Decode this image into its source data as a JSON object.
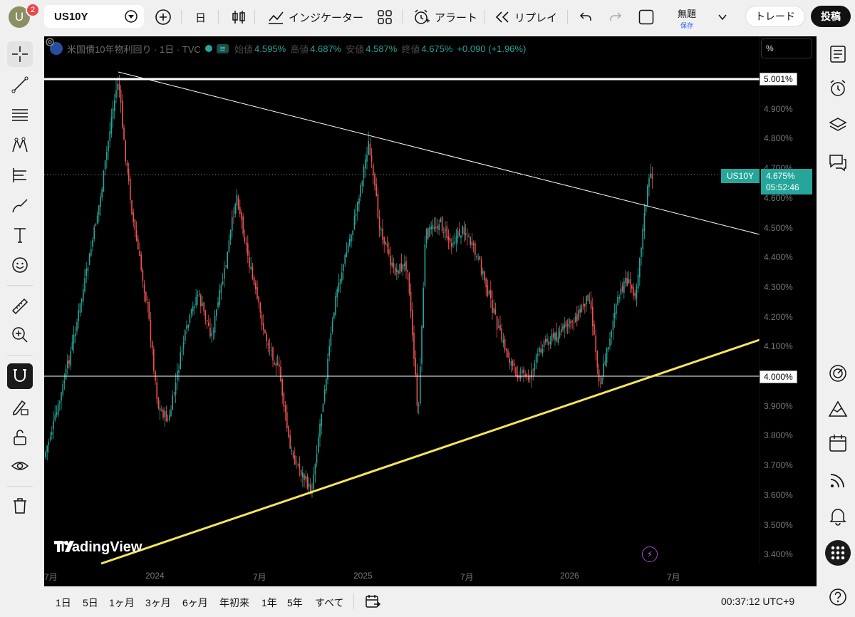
{
  "top": {
    "avatar_letter": "U",
    "notif_count": "2",
    "symbol": "US10Y",
    "timeframe": "日",
    "indicators": "インジケーター",
    "alert": "アラート",
    "replay": "リプレイ",
    "layout_title": "無題",
    "layout_saved": "保存",
    "trade": "トレード",
    "post": "投稿"
  },
  "legend": {
    "title": "米国債10年物利回り · 1日 · TVC",
    "wave": "≋",
    "open_label": "始値",
    "open": "4.595%",
    "high_label": "高値",
    "high": "4.687%",
    "low_label": "安値",
    "low": "4.587%",
    "close_label": "終値",
    "close": "4.675%",
    "change": "+0.090 (+1.96%)"
  },
  "scale_mode": "%",
  "price_axis": {
    "ticks": [
      "4.900%",
      "4.800%",
      "4.700%",
      "4.600%",
      "4.500%",
      "4.400%",
      "4.300%",
      "4.200%",
      "4.100%",
      "3.900%",
      "3.800%",
      "3.700%",
      "3.600%",
      "3.500%",
      "3.400%"
    ],
    "tag_top": "5.001%",
    "tag_mid": "4.000%",
    "ticker": "US10Y",
    "last_price": "4.675%",
    "countdown": "05:52:46"
  },
  "time_axis": [
    "7月",
    "2024",
    "7月",
    "2025",
    "7月",
    "2026",
    "7月"
  ],
  "watermark": "TradingView",
  "ranges": [
    "1日",
    "5日",
    "1ヶ月",
    "3ヶ月",
    "6ヶ月",
    "年初来",
    "1年",
    "5年",
    "すべて"
  ],
  "clock": "00:37:12 UTC+9",
  "colors": {
    "up": "#26a69a",
    "down": "#ef5350",
    "trend_support": "#f5e65a",
    "background": "#000000"
  }
}
